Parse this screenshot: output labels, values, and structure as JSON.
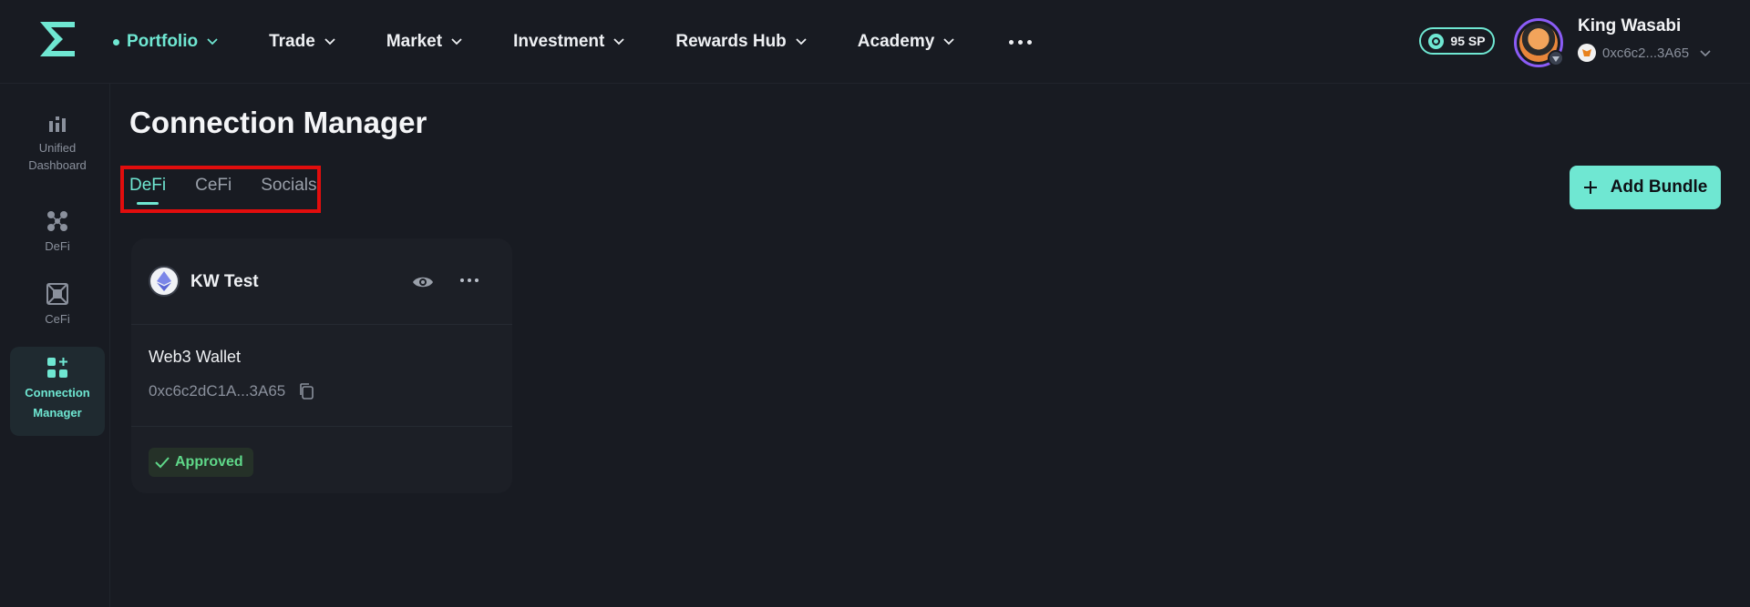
{
  "nav": {
    "items": [
      {
        "label": "Portfolio",
        "active": true
      },
      {
        "label": "Trade"
      },
      {
        "label": "Market"
      },
      {
        "label": "Investment"
      },
      {
        "label": "Rewards Hub"
      },
      {
        "label": "Academy"
      }
    ]
  },
  "user": {
    "sp": "95 SP",
    "name": "King Wasabi",
    "wallet": "0xc6c2...3A65"
  },
  "sidebar": {
    "items": [
      {
        "line1": "Unified",
        "line2": "Dashboard"
      },
      {
        "line1": "DeFi",
        "line2": ""
      },
      {
        "line1": "CeFi",
        "line2": ""
      },
      {
        "line1": "Connection",
        "line2": "Manager",
        "active": true
      }
    ]
  },
  "main": {
    "title": "Connection Manager",
    "tabs": [
      {
        "label": "DeFi",
        "active": true
      },
      {
        "label": "CeFi"
      },
      {
        "label": "Socials"
      }
    ],
    "add_bundle_label": "Add Bundle"
  },
  "card": {
    "title": "KW Test",
    "wallet_type": "Web3 Wallet",
    "address": "0xc6c2dC1A...3A65",
    "status": "Approved"
  },
  "colors": {
    "accent": "#6fe7d2",
    "background": "#181b22",
    "card": "#1c1f26",
    "approved": "#5fd889",
    "highlight": "#e10d0d"
  }
}
